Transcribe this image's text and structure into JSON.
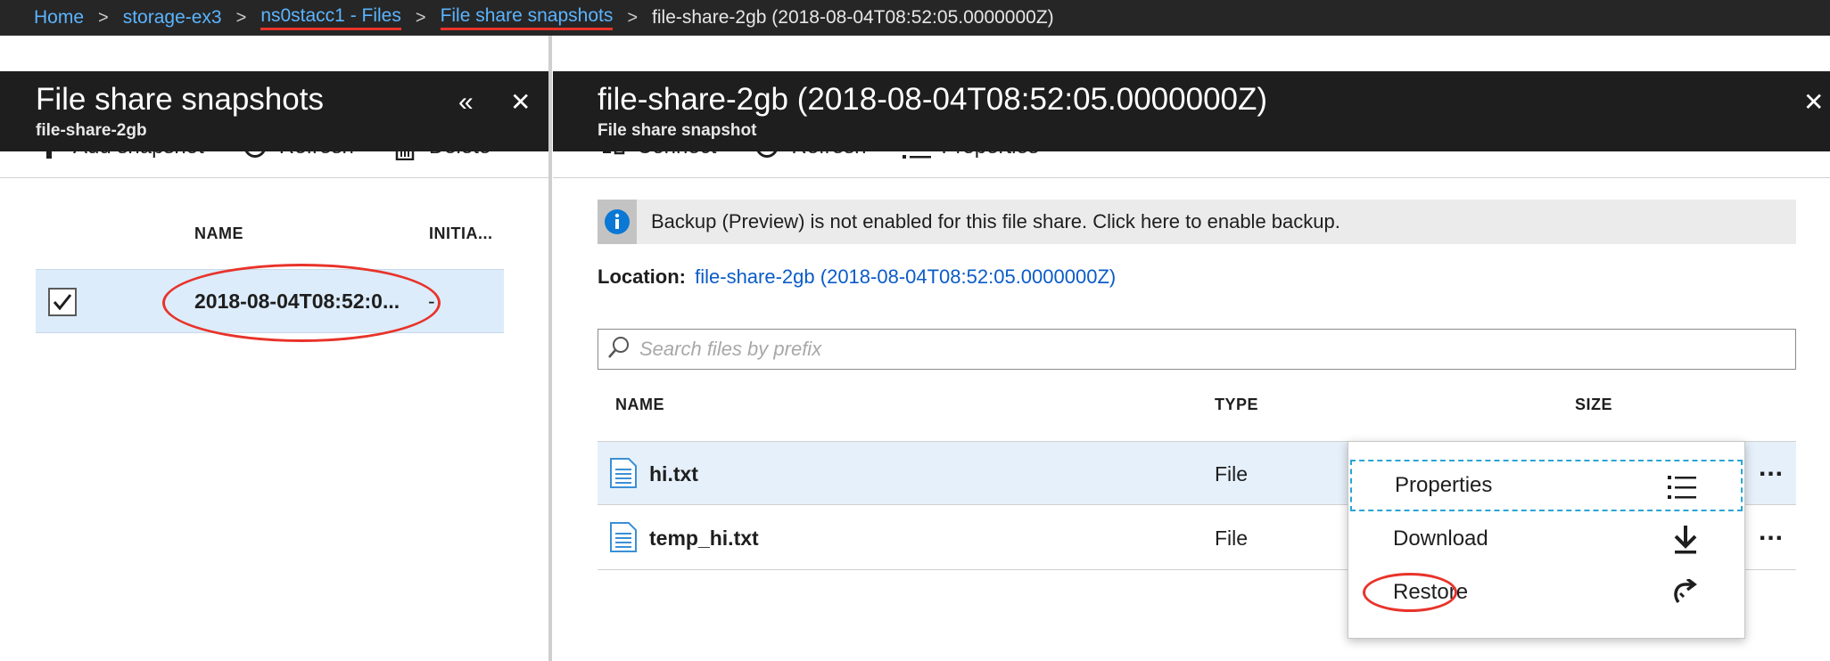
{
  "breadcrumb": {
    "items": [
      {
        "label": "Home"
      },
      {
        "label": "storage-ex3"
      },
      {
        "label": "ns0stacc1 - Files"
      },
      {
        "label": "File share snapshots"
      }
    ],
    "current": "file-share-2gb (2018-08-04T08:52:05.0000000Z)"
  },
  "left_blade": {
    "title": "File share snapshots",
    "subtitle": "file-share-2gb",
    "collapse_glyph": "«",
    "close_glyph": "✕",
    "toolbar": {
      "add": "Add snapshot",
      "refresh": "Refresh",
      "delete": "Delete"
    },
    "columns": {
      "name": "NAME",
      "initiator": "INITIA..."
    },
    "rows": [
      {
        "name": "2018-08-04T08:52:0...",
        "initiator": "-",
        "checked": true
      }
    ]
  },
  "right_blade": {
    "title": "file-share-2gb (2018-08-04T08:52:05.0000000Z)",
    "subtitle": "File share snapshot",
    "close_glyph": "✕",
    "toolbar": {
      "connect": "Connect",
      "refresh": "Refresh",
      "properties": "Properties"
    },
    "info_banner": "Backup (Preview) is not enabled for this file share. Click here to enable backup.",
    "location": {
      "label": "Location:",
      "value": "file-share-2gb (2018-08-04T08:52:05.0000000Z)"
    },
    "search": {
      "placeholder": "Search files by prefix",
      "value": ""
    },
    "columns": {
      "name": "NAME",
      "type": "TYPE",
      "size": "SIZE"
    },
    "files": [
      {
        "name": "hi.txt",
        "type": "File",
        "more": "..."
      },
      {
        "name": "temp_hi.txt",
        "type": "File",
        "more": "..."
      }
    ],
    "context_menu": {
      "properties": "Properties",
      "download": "Download",
      "restore": "Restore"
    }
  },
  "colors": {
    "link": "#0a5cc7",
    "breadcrumb_link": "#5bb4ff",
    "header_bg": "#1e1e1e",
    "selection_bg": "#dcecfb",
    "annotation_red": "#e8332a",
    "info_icon": "#0a78d4"
  },
  "icons": {
    "add": "plus-icon",
    "refresh": "refresh-icon",
    "delete": "trash-icon",
    "connect": "connect-plug-icon",
    "properties": "list-icon",
    "info": "info-icon",
    "search": "search-icon",
    "file": "file-document-icon",
    "download": "download-icon",
    "restore": "restore-arrow-icon"
  }
}
